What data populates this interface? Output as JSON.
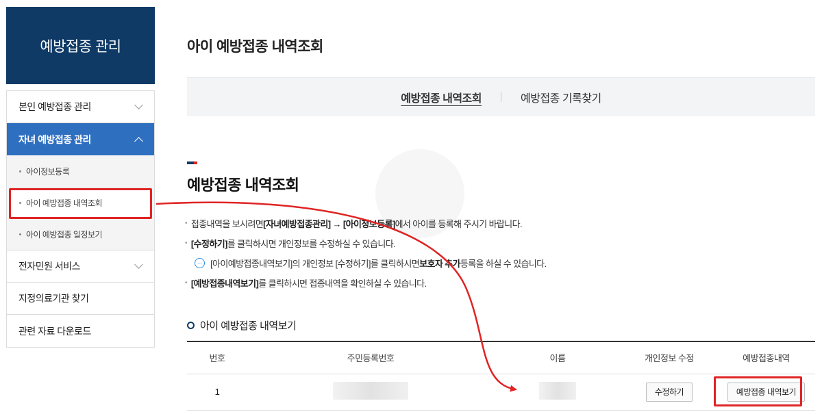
{
  "sidebar": {
    "title": "예방접종 관리",
    "items": [
      {
        "label": "본인 예방접종 관리"
      },
      {
        "label": "자녀 예방접종 관리"
      },
      {
        "label": "전자민원 서비스"
      },
      {
        "label": "지정의료기관 찾기"
      },
      {
        "label": "관련 자료 다운로드"
      }
    ],
    "subitems": [
      {
        "label": "아이정보등록"
      },
      {
        "label": "아이 예방접종 내역조회"
      },
      {
        "label": "아이 예방접종 일정보기"
      }
    ]
  },
  "page_title": "아이 예방접종 내역조회",
  "tabs": [
    {
      "label": "예방접종 내역조회"
    },
    {
      "label": "예방접종 기록찾기"
    }
  ],
  "section_title": "예방접종 내역조회",
  "notes": {
    "n1_a": "접종내역을 보시려면 ",
    "n1_b": "[자녀예방접종관리] → [아이정보등록]",
    "n1_c": "에서 아이를 등록해 주시기 바랍니다.",
    "n2_a": "[수정하기]",
    "n2_b": "를 클릭하시면 개인정보를 수정하실 수 있습니다.",
    "n3_a": "[아이예방접종내역보기]의 개인정보 [수정하기]를 클릭하시면 ",
    "n3_b": "보호자 추가",
    "n3_c": " 등록을 하실 수 있습니다.",
    "n4_a": "[예방접종내역보기]",
    "n4_b": "를 클릭하시면 접종내역을 확인하실 수 있습니다."
  },
  "subsection_title": "아이 예방접종 내역보기",
  "table": {
    "headers": [
      "번호",
      "주민등록번호",
      "이름",
      "개인정보 수정",
      "예방접종내역"
    ],
    "rows": [
      {
        "no": "1",
        "edit_label": "수정하기",
        "view_label": "예방접종 내역보기"
      }
    ]
  },
  "colors": {
    "navy": "#0f3a66",
    "active_blue": "#2f6fc0",
    "highlight_red": "#e02424"
  }
}
